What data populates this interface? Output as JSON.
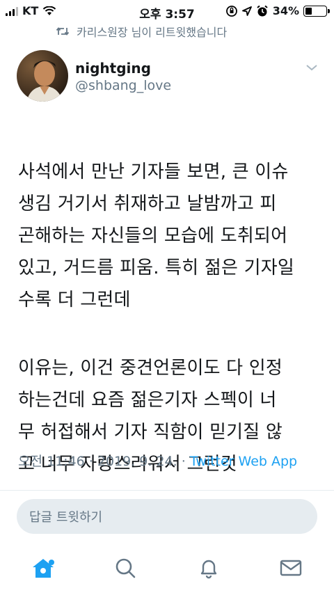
{
  "status_bar": {
    "carrier": "KT",
    "time": "오후 3:57",
    "battery_percent": "34%",
    "battery_level": 0.34,
    "icons": [
      "signal-icon",
      "wifi-icon",
      "orientation-lock-icon",
      "location-icon",
      "alarm-icon",
      "battery-icon"
    ]
  },
  "retweet_banner": {
    "text": "카리스원장 님이 리트윗했습니다",
    "icon": "retweet-icon"
  },
  "tweet": {
    "author_name": "nightging",
    "author_handle": "@shbang_love",
    "text_paragraph_1": "사석에서 만난 기자들 보면, 큰 이슈\n생김 거기서 취재하고 날밤까고 피\n곤해하는 자신들의 모습에 도취되어\n있고, 거드름 피움. 특히 젊은 기자일\n수록 더 그런데",
    "text_paragraph_2": "이유는, 이건 중견언론이도 다 인정\n하는건데 요즘 젊은기자 스펙이 너\n무 허접해서 기자 직함이 믿기질 않\n고 너무 자랑스러워서 그런것",
    "timestamp": "오전 11:46 · 2019. 9. 24. · ",
    "source": "Twitter Web App"
  },
  "reply_box": {
    "placeholder": "답글 트윗하기"
  },
  "tab_bar": {
    "tabs": [
      "home-icon",
      "search-icon",
      "notifications-icon",
      "messages-icon"
    ],
    "accent_color": "#1da1f2",
    "inactive_color": "#657786"
  }
}
